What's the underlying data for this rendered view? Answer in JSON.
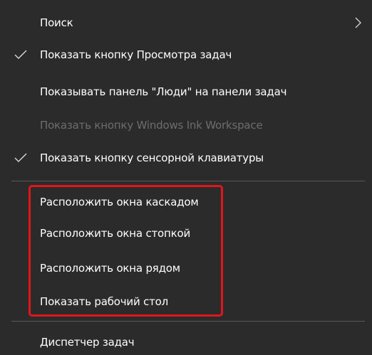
{
  "menu": {
    "top_items": [
      {
        "label": "Поиск",
        "checked": false,
        "disabled": false,
        "has_submenu": true
      },
      {
        "label": "Показать кнопку Просмотра задач",
        "checked": true,
        "disabled": false,
        "has_submenu": false
      },
      {
        "label": "Показывать панель \"Люди\" на панели задач",
        "checked": false,
        "disabled": false,
        "has_submenu": false
      },
      {
        "label": "Показать кнопку Windows Ink Workspace",
        "checked": false,
        "disabled": true,
        "has_submenu": false
      },
      {
        "label": "Показать кнопку сенсорной клавиатуры",
        "checked": true,
        "disabled": false,
        "has_submenu": false
      }
    ],
    "window_items": [
      {
        "label": "Расположить окна каскадом"
      },
      {
        "label": "Расположить окна стопкой"
      },
      {
        "label": "Расположить окна рядом"
      },
      {
        "label": "Показать рабочий стол"
      }
    ],
    "bottom_items": [
      {
        "label": "Диспетчер задач"
      }
    ]
  },
  "colors": {
    "background": "#2b2b2b",
    "text": "#ffffff",
    "disabled_text": "#6d6d6d",
    "separator": "#5a5a5a",
    "highlight_border": "#e2151b"
  },
  "icons": {
    "check": "check-icon",
    "submenu": "chevron-right-icon"
  }
}
